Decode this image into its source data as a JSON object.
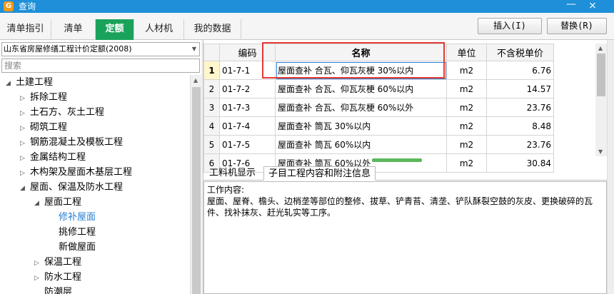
{
  "window": {
    "title": "查询",
    "min_glyph": "—",
    "close_glyph": "×"
  },
  "tabs": [
    {
      "label": "清单指引"
    },
    {
      "label": "清单"
    },
    {
      "label": "定额",
      "active": true
    },
    {
      "label": "人材机"
    },
    {
      "label": "我的数据"
    }
  ],
  "toolbar": {
    "insert_label": "插入(I)",
    "replace_label": "替换(R)"
  },
  "left_panel": {
    "library": "山东省房屋修缮工程计价定额(2008)",
    "search_placeholder": "搜索",
    "tree": [
      {
        "label": "土建工程",
        "level": 0,
        "toggle": "◢"
      },
      {
        "label": "拆除工程",
        "level": 1,
        "toggle": "▷"
      },
      {
        "label": "土石方、灰土工程",
        "level": 1,
        "toggle": "▷"
      },
      {
        "label": "砌筑工程",
        "level": 1,
        "toggle": "▷"
      },
      {
        "label": "钢筋混凝土及模板工程",
        "level": 1,
        "toggle": "▷"
      },
      {
        "label": "金属结构工程",
        "level": 1,
        "toggle": "▷"
      },
      {
        "label": "木构架及屋面木基层工程",
        "level": 1,
        "toggle": "▷"
      },
      {
        "label": "屋面、保温及防水工程",
        "level": 1,
        "toggle": "◢"
      },
      {
        "label": "屋面工程",
        "level": 2,
        "toggle": "◢"
      },
      {
        "label": "修补屋面",
        "level": 3,
        "toggle": "",
        "selected": true
      },
      {
        "label": "挑修工程",
        "level": 3,
        "toggle": ""
      },
      {
        "label": "新做屋面",
        "level": 3,
        "toggle": ""
      },
      {
        "label": "保温工程",
        "level": 2,
        "toggle": "▷"
      },
      {
        "label": "防水工程",
        "level": 2,
        "toggle": "▷"
      },
      {
        "label": "防潮层",
        "level": 2,
        "toggle": ""
      }
    ]
  },
  "grid": {
    "columns": {
      "code": "编码",
      "name": "名称",
      "unit": "单位",
      "price": "不含税单价"
    },
    "rows": [
      {
        "num": "1",
        "code": "01-7-1",
        "name": "屋面查补 合瓦、仰瓦灰梗 30%以内",
        "unit": "m2",
        "price": "6.76"
      },
      {
        "num": "2",
        "code": "01-7-2",
        "name": "屋面查补 合瓦、仰瓦灰梗 60%以内",
        "unit": "m2",
        "price": "14.57"
      },
      {
        "num": "3",
        "code": "01-7-3",
        "name": "屋面查补 合瓦、仰瓦灰梗 60%以外",
        "unit": "m2",
        "price": "23.76"
      },
      {
        "num": "4",
        "code": "01-7-4",
        "name": "屋面查补 筒瓦 30%以内",
        "unit": "m2",
        "price": "8.48"
      },
      {
        "num": "5",
        "code": "01-7-5",
        "name": "屋面查补 筒瓦 60%以内",
        "unit": "m2",
        "price": "23.76"
      },
      {
        "num": "6",
        "code": "01-7-6",
        "name": "屋面查补 筒瓦 60%以外",
        "unit": "m2",
        "price": "30.84"
      }
    ]
  },
  "detail": {
    "tabs": [
      {
        "label": "工料机显示"
      },
      {
        "label": "子目工程内容和附注信息",
        "active": true
      }
    ],
    "content_title": "工作内容:",
    "content_body": "屋面、屋脊、檐头、边梢垄等部位的整修、拔草、铲青苔、清垄、铲队酥裂空鼓的灰皮、更换破碎的瓦件、找补抹灰、赶光轧实等工序。"
  }
}
